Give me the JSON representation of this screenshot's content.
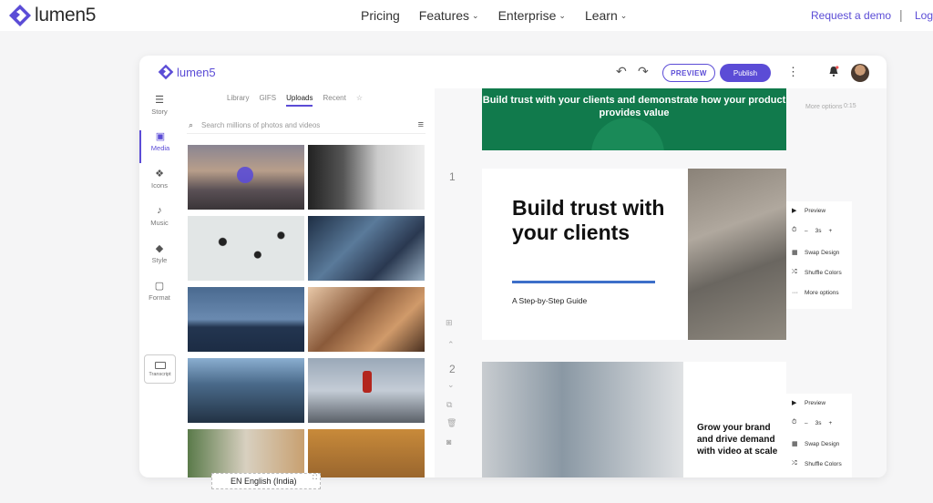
{
  "site": {
    "brand": "lumen5",
    "nav": [
      {
        "label": "Pricing",
        "dropdown": false
      },
      {
        "label": "Features",
        "dropdown": true
      },
      {
        "label": "Enterprise",
        "dropdown": true
      },
      {
        "label": "Learn",
        "dropdown": true
      }
    ],
    "request_demo": "Request a demo",
    "separator": "|",
    "login": "Log"
  },
  "app": {
    "brand": "lumen5",
    "preview_button": "PREVIEW",
    "publish_button": "Publish",
    "rail": [
      {
        "label": "Story",
        "icon": "story-icon"
      },
      {
        "label": "Media",
        "icon": "media-icon",
        "active": true
      },
      {
        "label": "Icons",
        "icon": "icons-icon"
      },
      {
        "label": "Music",
        "icon": "music-icon"
      },
      {
        "label": "Style",
        "icon": "style-icon"
      },
      {
        "label": "Format",
        "icon": "format-icon"
      }
    ],
    "transcript_label": "Transcript",
    "media_tabs": [
      "Library",
      "GIFS",
      "Uploads",
      "Recent"
    ],
    "active_tab": "Uploads",
    "search_placeholder": "Search millions of photos and videos",
    "language": "EN English (India)"
  },
  "scenes": {
    "scene0_text": "Build trust with your clients and demonstrate how your product provides value",
    "scene0_more": "More options",
    "scene0_time": "0:15",
    "scene1_number": "1",
    "scene1_heading": "Build trust with your clients",
    "scene1_sub": "A Step-by-Step Guide",
    "scene2_number": "2",
    "scene2_text": "Grow your brand and drive demand with video at scale"
  },
  "controls": {
    "preview": "Preview",
    "duration": "3s",
    "minus": "–",
    "plus": "+",
    "swap": "Swap Design",
    "shuffle": "Shuffle Colors",
    "more": "More options"
  },
  "colors": {
    "accent": "#5b4cd6",
    "scene_green": "#117a4c",
    "rule_blue": "#3d6fc9"
  }
}
